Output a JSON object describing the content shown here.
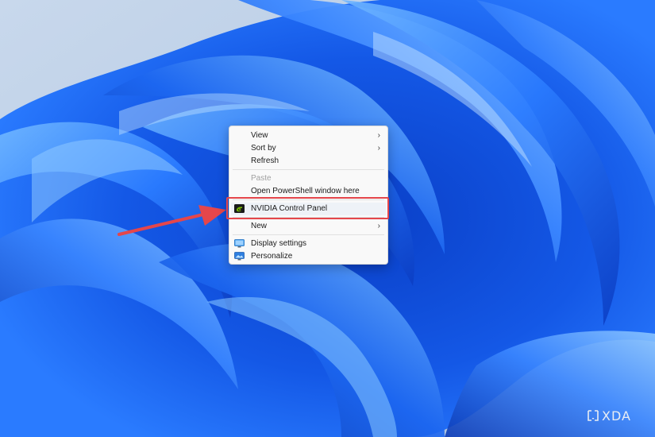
{
  "context_menu": {
    "items": [
      {
        "label": "View",
        "has_submenu": true,
        "disabled": false
      },
      {
        "label": "Sort by",
        "has_submenu": true,
        "disabled": false
      },
      {
        "label": "Refresh",
        "has_submenu": false,
        "disabled": false
      },
      {
        "label": "Paste",
        "has_submenu": false,
        "disabled": true
      },
      {
        "label": "Open PowerShell window here",
        "has_submenu": false,
        "disabled": false
      },
      {
        "label": "NVIDIA Control Panel",
        "has_submenu": false,
        "disabled": false,
        "icon": "nvidia-icon"
      },
      {
        "label": "New",
        "has_submenu": true,
        "disabled": false
      },
      {
        "label": "Display settings",
        "has_submenu": false,
        "disabled": false,
        "icon": "display-icon"
      },
      {
        "label": "Personalize",
        "has_submenu": false,
        "disabled": false,
        "icon": "personalize-icon"
      }
    ],
    "submenu_glyph": "›"
  },
  "annotation": {
    "highlight_color": "#e5464b",
    "arrow_color": "#e5464b"
  },
  "watermark": {
    "text": "XDA"
  },
  "colors": {
    "menu_background": "#f9f9f9",
    "wallpaper_blue": "#1a5fe0",
    "wallpaper_sky": "#b9cde6"
  }
}
